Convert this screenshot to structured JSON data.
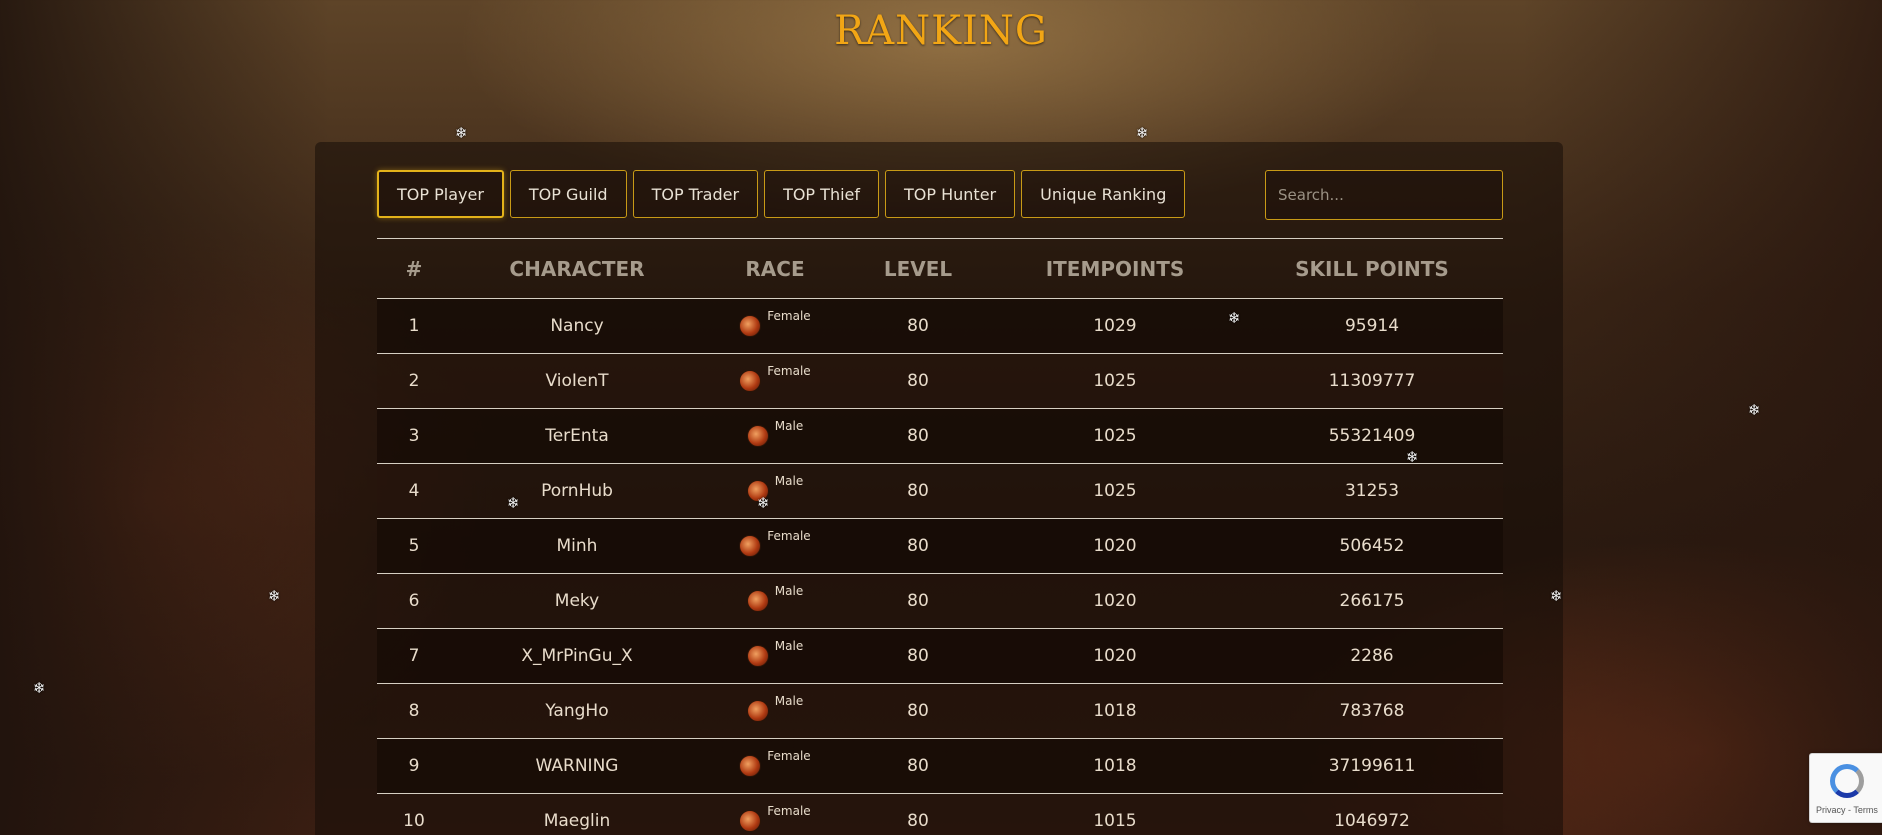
{
  "page": {
    "title": "RANKING"
  },
  "tabs": [
    {
      "label": "TOP Player",
      "active": true
    },
    {
      "label": "TOP Guild",
      "active": false
    },
    {
      "label": "TOP Trader",
      "active": false
    },
    {
      "label": "TOP Thief",
      "active": false
    },
    {
      "label": "TOP Hunter",
      "active": false
    },
    {
      "label": "Unique Ranking",
      "active": false
    }
  ],
  "search": {
    "placeholder": "Search..."
  },
  "table": {
    "headers": [
      "#",
      "CHARACTER",
      "RACE",
      "LEVEL",
      "ITEMPOINTS",
      "SKILL POINTS"
    ],
    "rows": [
      {
        "rank": "1",
        "character": "Nancy",
        "gender": "Female",
        "level": "80",
        "itempoints": "1029",
        "skillpoints": "95914"
      },
      {
        "rank": "2",
        "character": "VioIenT",
        "gender": "Female",
        "level": "80",
        "itempoints": "1025",
        "skillpoints": "11309777"
      },
      {
        "rank": "3",
        "character": "TerEnta",
        "gender": "Male",
        "level": "80",
        "itempoints": "1025",
        "skillpoints": "55321409"
      },
      {
        "rank": "4",
        "character": "PornHub",
        "gender": "Male",
        "level": "80",
        "itempoints": "1025",
        "skillpoints": "31253"
      },
      {
        "rank": "5",
        "character": "Minh",
        "gender": "Female",
        "level": "80",
        "itempoints": "1020",
        "skillpoints": "506452"
      },
      {
        "rank": "6",
        "character": "Meky",
        "gender": "Male",
        "level": "80",
        "itempoints": "1020",
        "skillpoints": "266175"
      },
      {
        "rank": "7",
        "character": "X_MrPinGu_X",
        "gender": "Male",
        "level": "80",
        "itempoints": "1020",
        "skillpoints": "2286"
      },
      {
        "rank": "8",
        "character": "YangHo",
        "gender": "Male",
        "level": "80",
        "itempoints": "1018",
        "skillpoints": "783768"
      },
      {
        "rank": "9",
        "character": "WARNING",
        "gender": "Female",
        "level": "80",
        "itempoints": "1018",
        "skillpoints": "37199611"
      },
      {
        "rank": "10",
        "character": "Maeglin",
        "gender": "Female",
        "level": "80",
        "itempoints": "1015",
        "skillpoints": "1046972"
      }
    ]
  },
  "race_icon": "chinese-race-icon",
  "decorations": {
    "snowflake_glyph": "❄"
  },
  "recaptcha": {
    "links": "Privacy - Terms"
  },
  "colors": {
    "accent": "#f2a615",
    "border": "#c89a16",
    "name": "#cdb04a"
  }
}
